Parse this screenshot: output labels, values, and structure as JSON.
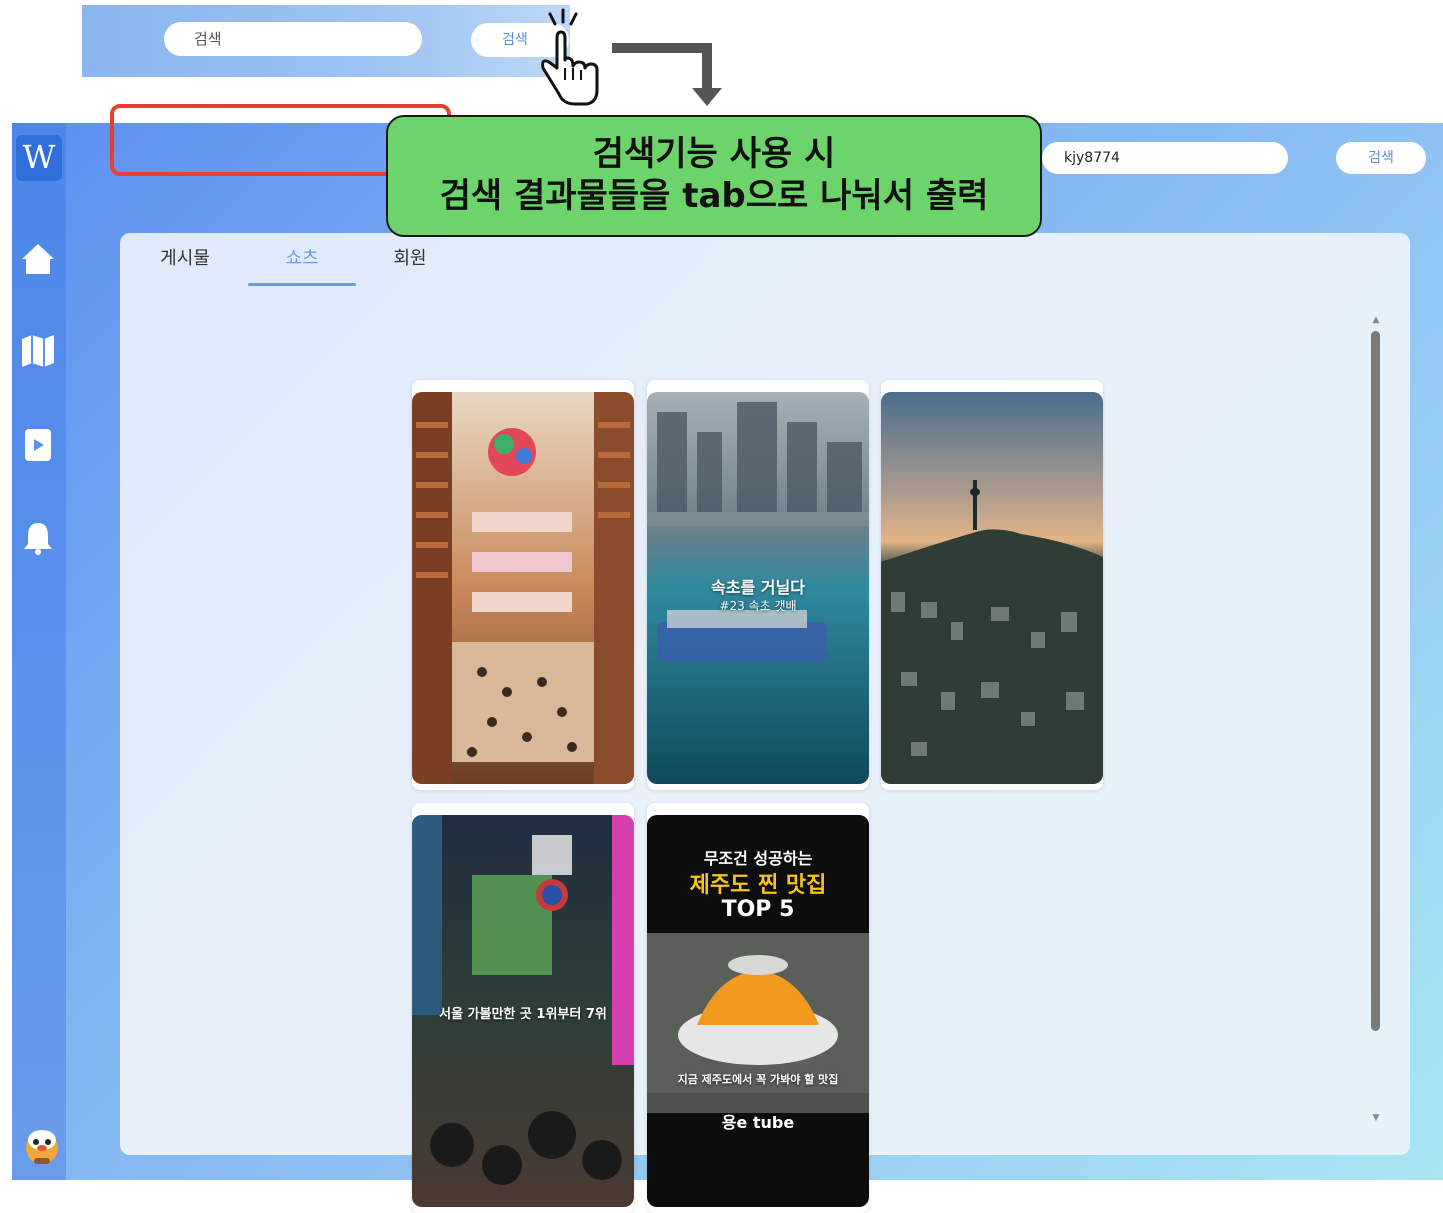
{
  "inset": {
    "search_placeholder": "검색",
    "search_button": "검색"
  },
  "header": {
    "search_value": "kjy8774",
    "search_button": "검색"
  },
  "sidebar": {
    "logo": "W",
    "items": [
      {
        "icon": "home-icon"
      },
      {
        "icon": "map-icon"
      },
      {
        "icon": "video-icon"
      },
      {
        "icon": "bell-icon"
      }
    ]
  },
  "tabs": [
    {
      "label": "게시물",
      "active": false
    },
    {
      "label": "쇼츠",
      "active": true
    },
    {
      "label": "회원",
      "active": false
    }
  ],
  "callout": {
    "line1": "검색기능 사용 시",
    "line2": "검색 결과물들을 tab으로 나눠서 출력"
  },
  "shorts": [
    {
      "image": "starfield-library",
      "overlay": []
    },
    {
      "image": "sokcho-harbor",
      "overlay": [
        "속초를 거닐다",
        "#23 속초 갯배"
      ]
    },
    {
      "image": "namsan-tower-city",
      "overlay": []
    },
    {
      "image": "seoul-street-night",
      "overlay": [
        "서울 가볼만한 곳 1위부터 7위"
      ]
    },
    {
      "image": "jeju-mango-dessert",
      "overlay": [
        "무조건 성공하는",
        "제주도 찐 맛집",
        "TOP 5",
        "지금 제주도에서 꼭 가봐야 할 맛집",
        "용e tube"
      ]
    }
  ],
  "colors": {
    "accent": "#6a9be8",
    "highlight_border": "#e8402f",
    "callout_bg": "#6dd46b"
  }
}
